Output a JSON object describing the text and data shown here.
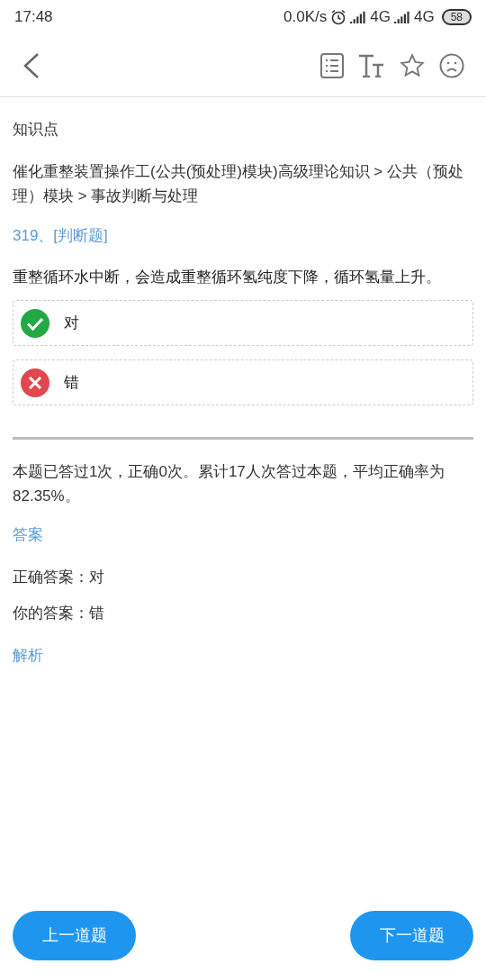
{
  "status_bar": {
    "time": "17:48",
    "speed": "0.0K/s",
    "network_1": "4G",
    "network_2": "4G",
    "battery": "58"
  },
  "knowledge": {
    "label": "知识点",
    "path": "催化重整装置操作工(公共(预处理)模块)高级理论知识 > 公共（预处理）模块 > 事故判断与处理"
  },
  "question": {
    "number": "319、[判断题]",
    "text": "重整循环水中断，会造成重整循环氢纯度下降，循环氢量上升。",
    "options": [
      {
        "kind": "correct",
        "label": "对"
      },
      {
        "kind": "wrong",
        "label": "错"
      }
    ]
  },
  "stats": "本题已答过1次，正确0次。累计17人次答过本题，平均正确率为82.35%。",
  "answer": {
    "heading": "答案",
    "correct": "正确答案：对",
    "yours": "你的答案：错"
  },
  "analysis": {
    "heading": "解析"
  },
  "buttons": {
    "prev": "上一道题",
    "next": "下一道题"
  }
}
